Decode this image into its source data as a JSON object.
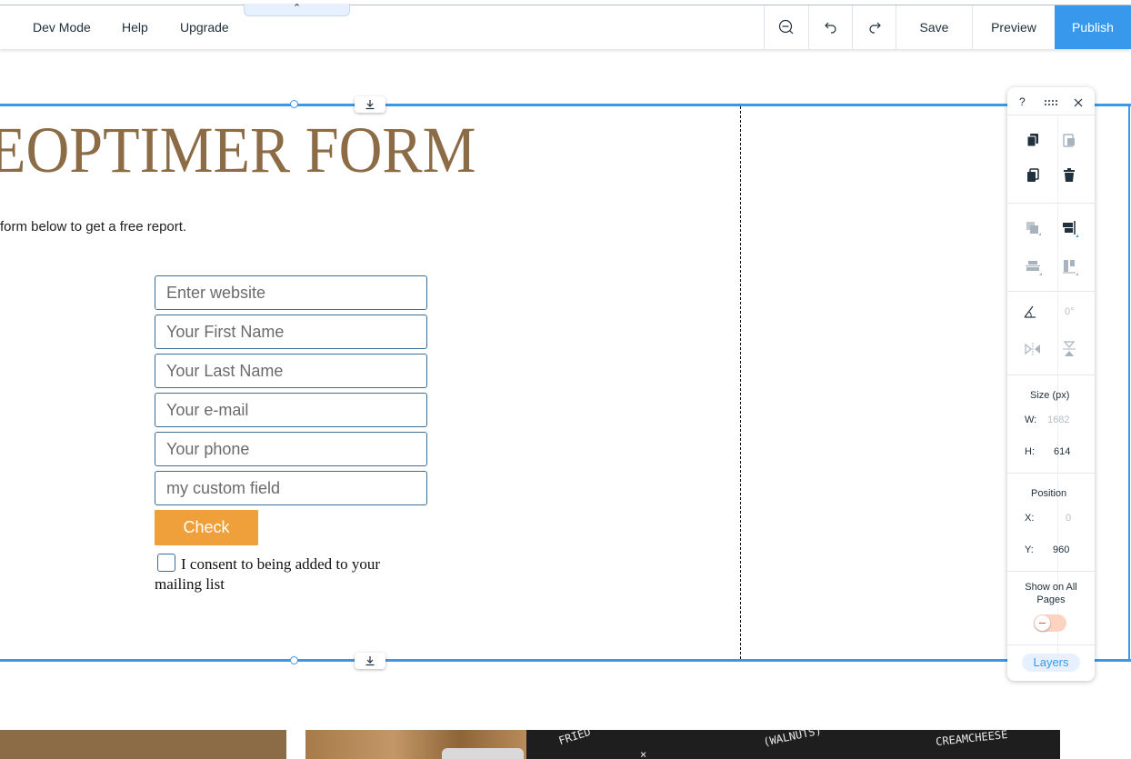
{
  "topbar": {
    "menu": [
      "Dev Mode",
      "Help",
      "Upgrade"
    ],
    "collapse_glyph": "⌃",
    "tools": {
      "zoom_out": "zoom-out-icon",
      "undo": "undo-icon",
      "redo": "redo-icon"
    },
    "save_label": "Save",
    "preview_label": "Preview",
    "publish_label": "Publish"
  },
  "canvas": {
    "title": "EOPTIMER FORM",
    "subtitle": "form below to get a free report."
  },
  "form": {
    "fields": [
      {
        "placeholder": "Enter website"
      },
      {
        "placeholder": "Your First Name"
      },
      {
        "placeholder": "Your Last Name"
      },
      {
        "placeholder": "Your e-mail"
      },
      {
        "placeholder": "Your phone"
      },
      {
        "placeholder": "my custom field"
      }
    ],
    "submit_label": "Check",
    "consent_label": "I consent to being added to your mailing list",
    "consent_checked": false
  },
  "panel": {
    "help": "?",
    "size_title": "Size (px)",
    "w_label": "W:",
    "w_value": "1682",
    "h_label": "H:",
    "h_value": "614",
    "position_title": "Position",
    "x_label": "X:",
    "x_value": "0",
    "y_label": "Y:",
    "y_value": "960",
    "rotation_value": "0°",
    "show_all_pages_label": "Show on All Pages",
    "show_all_pages_on": false,
    "layers_label": "Layers"
  },
  "colors": {
    "accent": "#3899ec",
    "title": "#8c6c46",
    "submit": "#f0a03a"
  }
}
